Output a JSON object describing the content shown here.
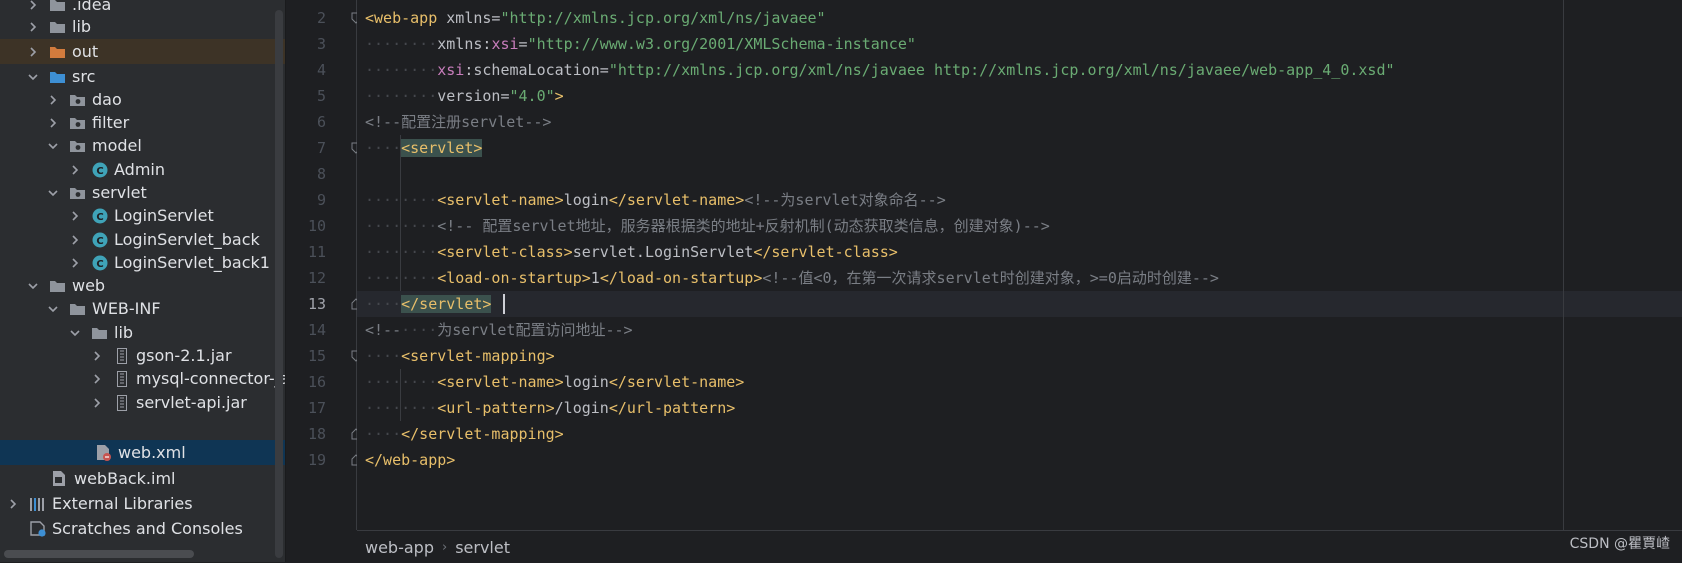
{
  "project_tree": {
    "items": [
      {
        "label": ".idea",
        "type": "folder"
      },
      {
        "label": "lib",
        "type": "folder"
      },
      {
        "label": "out",
        "type": "folder-excluded"
      },
      {
        "label": "src",
        "type": "folder-src"
      },
      {
        "label": "dao",
        "type": "package"
      },
      {
        "label": "filter",
        "type": "package"
      },
      {
        "label": "model",
        "type": "package"
      },
      {
        "label": "Admin",
        "type": "class"
      },
      {
        "label": "servlet",
        "type": "package"
      },
      {
        "label": "LoginServlet",
        "type": "class"
      },
      {
        "label": "LoginServlet_back",
        "type": "class"
      },
      {
        "label": "LoginServlet_back1",
        "type": "class"
      },
      {
        "label": "web",
        "type": "folder-web"
      },
      {
        "label": "WEB-INF",
        "type": "folder"
      },
      {
        "label": "lib",
        "type": "folder"
      },
      {
        "label": "gson-2.1.jar",
        "type": "jar"
      },
      {
        "label": "mysql-connector-java",
        "type": "jar"
      },
      {
        "label": "servlet-api.jar",
        "type": "jar"
      },
      {
        "label": "web.xml",
        "type": "xml"
      },
      {
        "label": "webBack.iml",
        "type": "iml"
      },
      {
        "label": "External Libraries",
        "type": "libraries"
      },
      {
        "label": "Scratches and Consoles",
        "type": "scratches"
      }
    ]
  },
  "editor": {
    "line_numbers": [
      "2",
      "3",
      "4",
      "5",
      "6",
      "7",
      "8",
      "9",
      "10",
      "11",
      "12",
      "13",
      "14",
      "15",
      "16",
      "17",
      "18",
      "19"
    ],
    "current_line": "13",
    "lines": {
      "l2": {
        "t1": "<web-app",
        "a1": " xmlns=",
        "v1": "\"http://xmlns.jcp.org/xml/ns/javaee\""
      },
      "l3": {
        "ws": "········",
        "a1": "xmlns:",
        "ns": "xsi",
        "eq": "=",
        "v1": "\"http://www.w3.org/2001/XMLSchema-instance\""
      },
      "l4": {
        "ws": "········",
        "ns": "xsi",
        "a1": ":schemaLocation=",
        "v1": "\"http://xmlns.jcp.org/xml/ns/javaee http://xmlns.jcp.org/xml/ns/javaee/web-app_4_0.xsd\""
      },
      "l5": {
        "ws": "········",
        "a1": "version=",
        "v1": "\"4.0\"",
        "t1": ">"
      },
      "l6": {
        "c1": "<!--配置注册servlet-->"
      },
      "l7": {
        "ws": "····",
        "t1": "<servlet>"
      },
      "l8": {},
      "l9": {
        "ws": "········",
        "t1": "<servlet-name>",
        "x1": "login",
        "t2": "</servlet-name>",
        "c1": "<!--为servlet对象命名-->"
      },
      "l10": {
        "ws": "········",
        "c1": "<!-- 配置servlet地址，服务器根据类的地址+反射机制(动态获取类信息，创建对象)-->"
      },
      "l11": {
        "ws": "········",
        "t1": "<servlet-class>",
        "x1": "servlet.LoginServlet",
        "t2": "</servlet-class>"
      },
      "l12": {
        "ws": "········",
        "t1": "<load-on-startup>",
        "x1": "1",
        "t2": "</load-on-startup>",
        "c1": "<!--值<0，在第一次请求servlet时创建对象，>=0启动时创建-->"
      },
      "l13": {
        "ws": "····",
        "t1": "</servlet>"
      },
      "l14": {
        "c1": "<!--",
        "ws": "····",
        "c2": "为servlet配置访问地址-->"
      },
      "l15": {
        "ws": "····",
        "t1": "<servlet-mapping>"
      },
      "l16": {
        "ws": "········",
        "t1": "<servlet-name>",
        "x1": "login",
        "t2": "</servlet-name>"
      },
      "l17": {
        "ws": "········",
        "t1": "<url-pattern>",
        "x1": "/login",
        "t2": "</url-pattern>"
      },
      "l18": {
        "ws": "····",
        "t1": "</servlet-mapping>"
      },
      "l19": {
        "t1": "</web-app>"
      }
    }
  },
  "breadcrumbs": {
    "items": [
      "web-app",
      "servlet"
    ],
    "separator": "›"
  },
  "watermark": "CSDN @瞿賈嵖",
  "colors": {
    "tree_bg": "#2b2d30",
    "editor_bg": "#1e1f22",
    "tag": "#e8bf6a",
    "string": "#6aab73",
    "namespace": "#c77dbb",
    "comment": "#7a7e85",
    "selected_row": "#0f3554"
  }
}
